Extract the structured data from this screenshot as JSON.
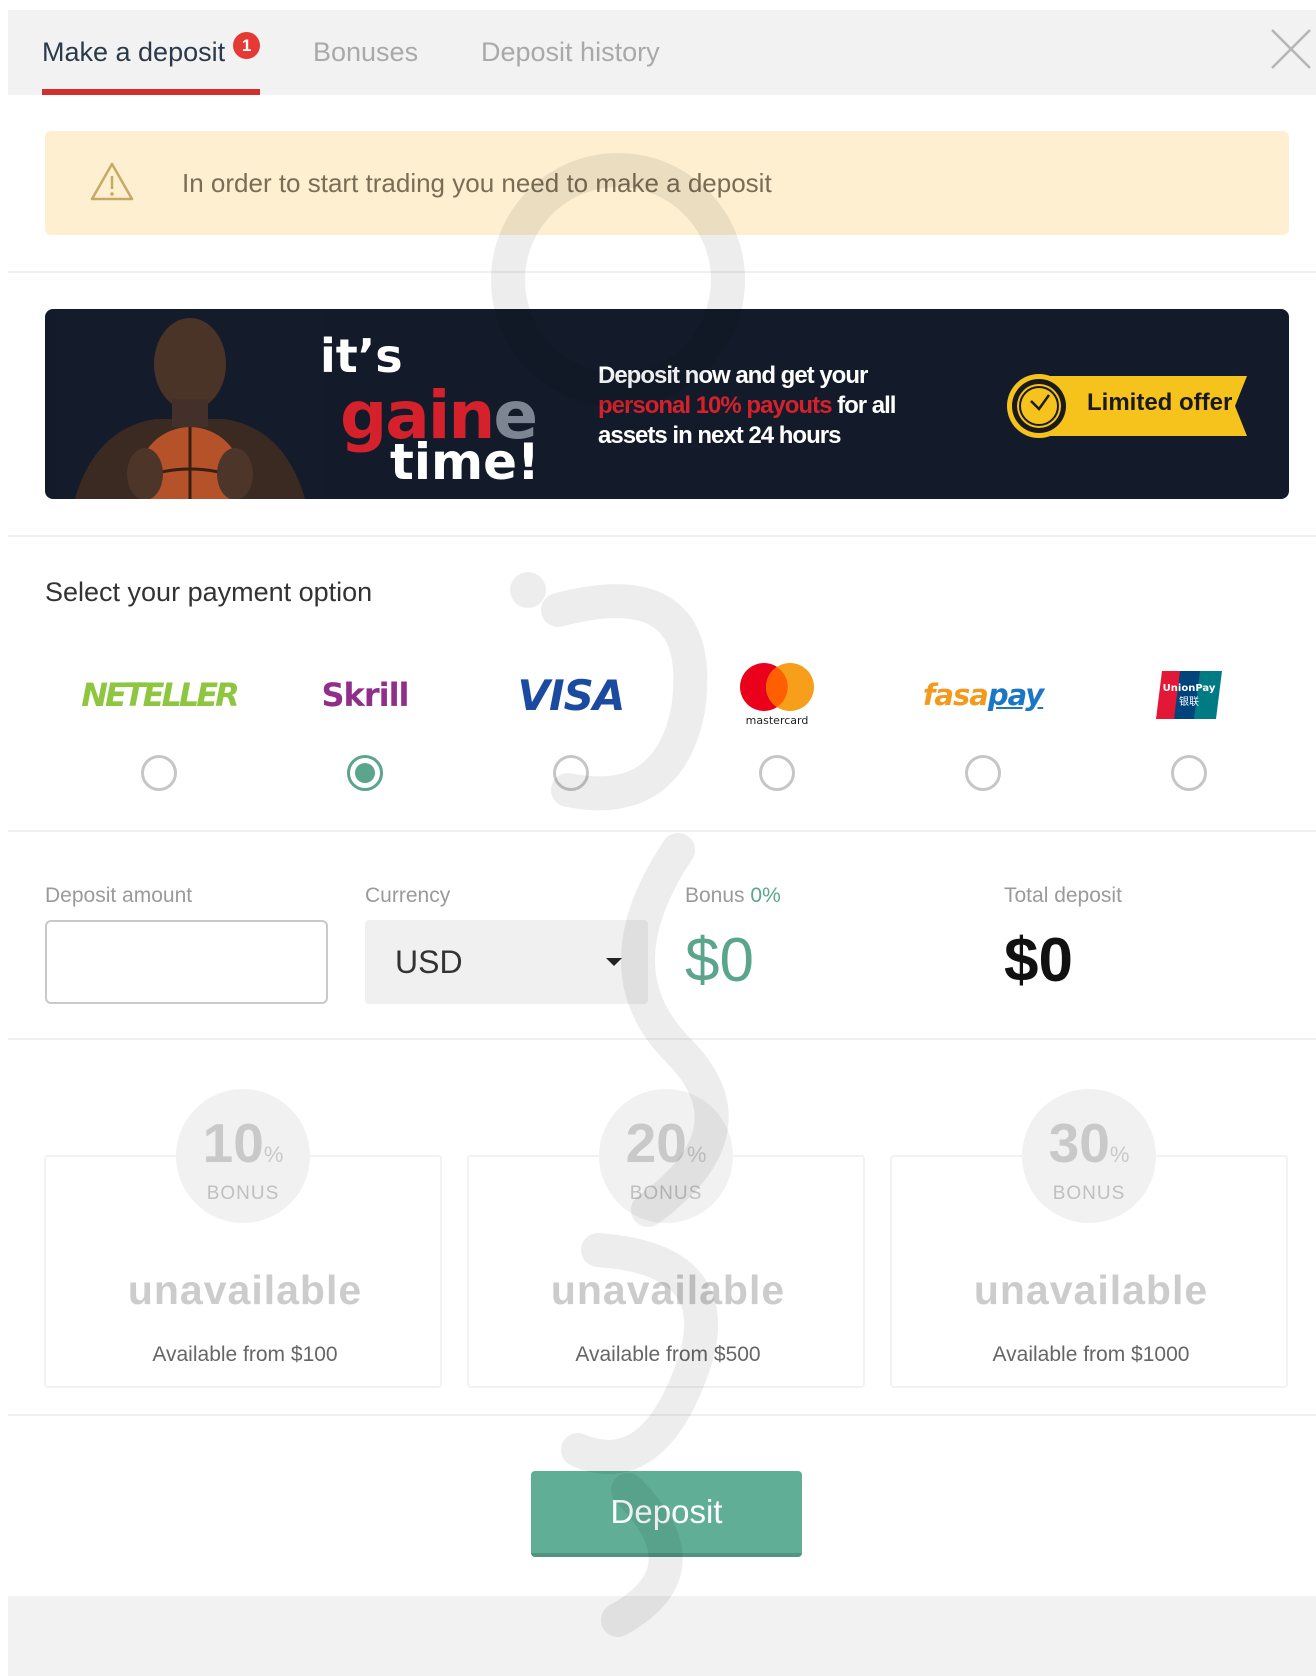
{
  "tabs": [
    {
      "label": "Make a deposit",
      "badge": "1",
      "active": true
    },
    {
      "label": "Bonuses",
      "active": false
    },
    {
      "label": "Deposit history",
      "active": false
    }
  ],
  "alert": {
    "text": "In order to start trading you need to make a deposit",
    "icon": "warning-icon"
  },
  "banner": {
    "its": "it’s",
    "game_main": "gain",
    "game_faded": "e",
    "time": "time!",
    "promo_line1": "Deposit now and get your",
    "promo_red": "personal 10% payouts",
    "promo_line2": " for all",
    "promo_line3": "assets in next 24 hours",
    "offer_label": "Limited offer"
  },
  "payment": {
    "title": "Select your payment option",
    "selected": "skrill",
    "methods": [
      {
        "id": "neteller",
        "label": "NETELLER",
        "checked": false
      },
      {
        "id": "skrill",
        "label": "Skrill",
        "checked": true
      },
      {
        "id": "visa",
        "label": "VISA",
        "checked": false
      },
      {
        "id": "mastercard",
        "label": "mastercard",
        "checked": false
      },
      {
        "id": "fasapay",
        "label_a": "fasa",
        "label_b": "pay",
        "checked": false
      },
      {
        "id": "unionpay",
        "label": "UnionPay",
        "label_cn": "银联",
        "checked": false
      }
    ]
  },
  "form": {
    "amount_label": "Deposit amount",
    "amount_value": "",
    "currency_label": "Currency",
    "currency_value": "USD",
    "bonus_label": "Bonus ",
    "bonus_pct": "0%",
    "bonus_value": "$0",
    "total_label": "Total deposit",
    "total_value": "$0"
  },
  "bonuses": [
    {
      "pct": "10",
      "unit": "%",
      "label": "BONUS",
      "status": "unavailable",
      "note": "Available from $100"
    },
    {
      "pct": "20",
      "unit": "%",
      "label": "BONUS",
      "status": "unavailable",
      "note": "Available from $500"
    },
    {
      "pct": "30",
      "unit": "%",
      "label": "BONUS",
      "status": "unavailable",
      "note": "Available from $1000"
    }
  ],
  "deposit_button": "Deposit",
  "colors": {
    "accent_green": "#5aa58c",
    "tab_red": "#d32f2f",
    "alert_bg": "#fdefcf",
    "banner_bg": "#131b2a",
    "offer_yellow": "#f6c21c"
  }
}
